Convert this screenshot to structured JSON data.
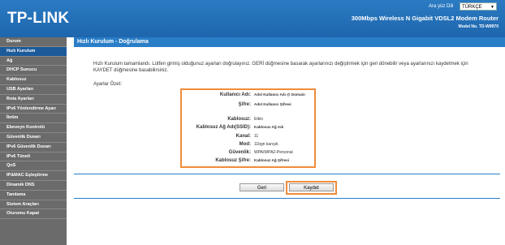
{
  "header": {
    "logo": "TP-LINK",
    "language_label": "Ara yüz Dili",
    "language_value": "TÜRKÇE",
    "product_title": "300Mbps Wireless N Gigabit VDSL2 Modem Router",
    "model_number": "Model No. TD-W9970",
    "colors": {
      "header_blue": "#1e66ad",
      "accent_orange": "#f08c3a",
      "sidebar_gray": "#6b6b6b",
      "active_nav": "#1c5a9a"
    }
  },
  "sidebar": {
    "items": [
      {
        "label": "Durum"
      },
      {
        "label": "Hızlı Kurulum",
        "active": true
      },
      {
        "label": "Ağ"
      },
      {
        "label": "DHCP Sunucu"
      },
      {
        "label": "Kablosuz"
      },
      {
        "label": "USB Ayarları"
      },
      {
        "label": "Rota Ayarları"
      },
      {
        "label": "IPv6 Yönlendirme Ayarı"
      },
      {
        "label": "İletim"
      },
      {
        "label": "Ebeveyn Kontrolü"
      },
      {
        "label": "Güvenlik Duvarı"
      },
      {
        "label": "IPv6 Güvenlik Duvarı"
      },
      {
        "label": "IPv6 Tüneli"
      },
      {
        "label": "QoS"
      },
      {
        "label": "IP&MAC Eşleştirme"
      },
      {
        "label": "Dinamik DNS"
      },
      {
        "label": "Tanılama"
      },
      {
        "label": "Sistem Araçları"
      },
      {
        "label": "Oturumu Kapat"
      }
    ]
  },
  "main": {
    "title": "Hızlı Kurulum - Doğrulama",
    "intro": "Hızlı Kurulum tamamlandı. Lütfen girmiş olduğunuz ayarları doğrulayınız. GERİ düğmesine basarak ayarlarınızı değiştirmek için geri dönebilir veya ayarlarınızı kaydetmek için KAYDET düğmesine basabilirsiniz.",
    "summary_label": "Ayarlar Özet:",
    "summary": {
      "username_label": "Kullanıcı Adı:",
      "username_value": "Adsl Kullanıcı Adı @ Domain",
      "password_label": "Şifre:",
      "password_value": "Adsl Kullanıcı Şifresi",
      "wireless_label": "Kablosuz:",
      "wireless_value": "Etkin",
      "ssid_label": "Kablosuz Ağ Adı(SSID):",
      "ssid_value": "Kablosuz Ağ Adı",
      "channel_label": "Kanal:",
      "channel_value": "11",
      "mode_label": "Mod:",
      "mode_value": "11bgn karışık",
      "security_label": "Güvenlik:",
      "security_value": "WPA/WPA2-Personal",
      "wifi_password_label": "Kablosuz Şifre:",
      "wifi_password_value": "Kablosuz Ağ Şifresi"
    },
    "buttons": {
      "back": "Geri",
      "save": "Kaydet"
    }
  }
}
